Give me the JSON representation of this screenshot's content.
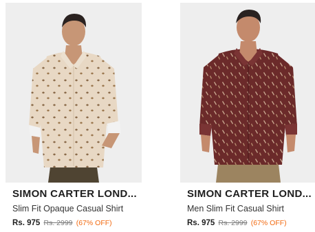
{
  "products": [
    {
      "brand": "SIMON CARTER LOND...",
      "name": "Slim Fit Opaque Casual Shirt",
      "price": "Rs. 975",
      "mrp": "Rs. 2999",
      "discount": "(67% OFF)",
      "shirt_color": "#e8d8c4",
      "pant_color": "#4f4432"
    },
    {
      "brand": "SIMON CARTER LOND...",
      "name": "Men Slim Fit Casual Shirt",
      "price": "Rs. 975",
      "mrp": "Rs. 2999",
      "discount": "(67% OFF)",
      "shirt_color": "#6b2a2a",
      "pant_color": "#9c8460"
    }
  ],
  "colors": {
    "discount": "#f26a10",
    "image_background": "#eeeeee"
  }
}
